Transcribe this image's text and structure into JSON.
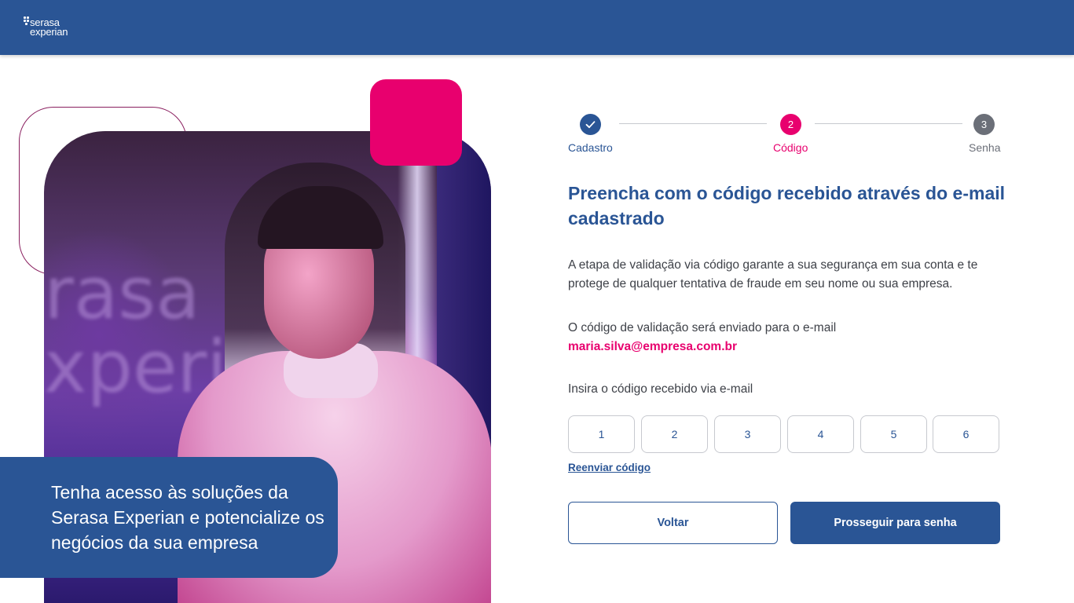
{
  "header": {
    "logo_line1": "serasa",
    "logo_line2": "experian"
  },
  "hero": {
    "background_text": "rasa\nxperi",
    "promo_text": "Tenha acesso às soluções da Serasa Experian e potencialize os negócios da sua empresa"
  },
  "stepper": {
    "steps": [
      {
        "label": "Cadastro",
        "state": "done",
        "icon": "check-icon"
      },
      {
        "label": "Código",
        "number": "2",
        "state": "active"
      },
      {
        "label": "Senha",
        "number": "3",
        "state": "pending"
      }
    ]
  },
  "content": {
    "title": "Preencha com o código recebido através do e-mail cadastrado",
    "description": "A etapa de validação via código garante a sua segurança em sua conta e te protege de qualquer tentativa de fraude em seu nome ou sua empresa.",
    "sent_text": "O código de validação será enviado para o e-mail",
    "email": "maria.silva@empresa.com.br",
    "code_prompt": "Insira o código recebido via e-mail",
    "code_digits": [
      "1",
      "2",
      "3",
      "4",
      "5",
      "6"
    ],
    "resend_label": "Reenviar código"
  },
  "actions": {
    "back_label": "Voltar",
    "next_label": "Prosseguir para senha"
  },
  "colors": {
    "primary": "#2a5595",
    "accent": "#e8006e",
    "muted": "#6b6f78"
  }
}
